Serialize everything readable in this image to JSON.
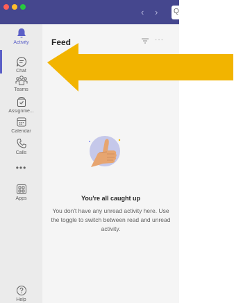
{
  "window": {
    "nav_back": "‹",
    "nav_forward": "›",
    "search_glyph": "Q"
  },
  "rail": {
    "items": [
      {
        "label": "Activity",
        "icon": "bell-icon",
        "active": true
      },
      {
        "label": "Chat",
        "icon": "chat-icon"
      },
      {
        "label": "Teams",
        "icon": "teams-icon"
      },
      {
        "label": "Assignme...",
        "icon": "assignments-icon"
      },
      {
        "label": "Calendar",
        "icon": "calendar-icon"
      },
      {
        "label": "Calls",
        "icon": "phone-icon"
      },
      {
        "label": "Apps",
        "icon": "apps-icon"
      },
      {
        "label": "Help",
        "icon": "help-icon"
      }
    ],
    "more_glyph": "•••"
  },
  "feed": {
    "title": "Feed",
    "more_glyph": "···",
    "empty_title": "You're all caught up",
    "empty_body": "You don't have any unread activity here. Use the toggle to switch between read and unread activity."
  },
  "colors": {
    "titlebar": "#45478e",
    "accent": "#5b5fc7",
    "annotation_arrow": "#f2b400"
  }
}
